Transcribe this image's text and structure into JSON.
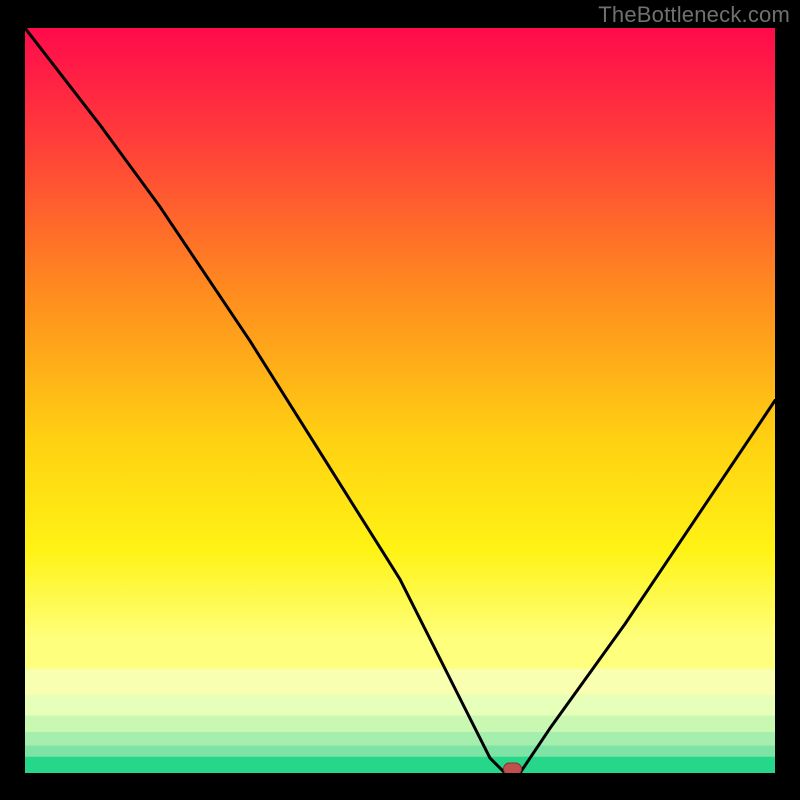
{
  "watermark": "TheBottleneck.com",
  "chart_data": {
    "type": "line",
    "title": "",
    "xlabel": "",
    "ylabel": "",
    "xlim": [
      0,
      100
    ],
    "ylim": [
      0,
      100
    ],
    "grid": false,
    "series": [
      {
        "name": "bottleneck-curve",
        "x": [
          0,
          10,
          18,
          30,
          40,
          50,
          58,
          62,
          64,
          66,
          70,
          80,
          90,
          100
        ],
        "values": [
          100,
          87,
          76,
          58,
          42,
          26,
          10,
          2,
          0,
          0,
          6,
          20,
          35,
          50
        ]
      }
    ],
    "marker": {
      "name": "optimum-marker",
      "x": 65,
      "y": 0,
      "color": "#c0504d"
    },
    "background": {
      "type": "gradient-with-bands",
      "stops": [
        {
          "pos": 0.0,
          "color": "#ff0a4c"
        },
        {
          "pos": 0.15,
          "color": "#ff3d3a"
        },
        {
          "pos": 0.35,
          "color": "#ff8a1f"
        },
        {
          "pos": 0.55,
          "color": "#ffd012"
        },
        {
          "pos": 0.7,
          "color": "#fff314"
        },
        {
          "pos": 0.82,
          "color": "#feff7c"
        }
      ],
      "bands": [
        {
          "y": 0.86,
          "h": 0.035,
          "color": "#f8ffb0"
        },
        {
          "y": 0.895,
          "h": 0.028,
          "color": "#e6ffb9"
        },
        {
          "y": 0.923,
          "h": 0.022,
          "color": "#c9f8b3"
        },
        {
          "y": 0.945,
          "h": 0.018,
          "color": "#a5eeae"
        },
        {
          "y": 0.963,
          "h": 0.015,
          "color": "#7de4a6"
        },
        {
          "y": 0.978,
          "h": 0.022,
          "color": "#26d78a"
        }
      ]
    }
  }
}
